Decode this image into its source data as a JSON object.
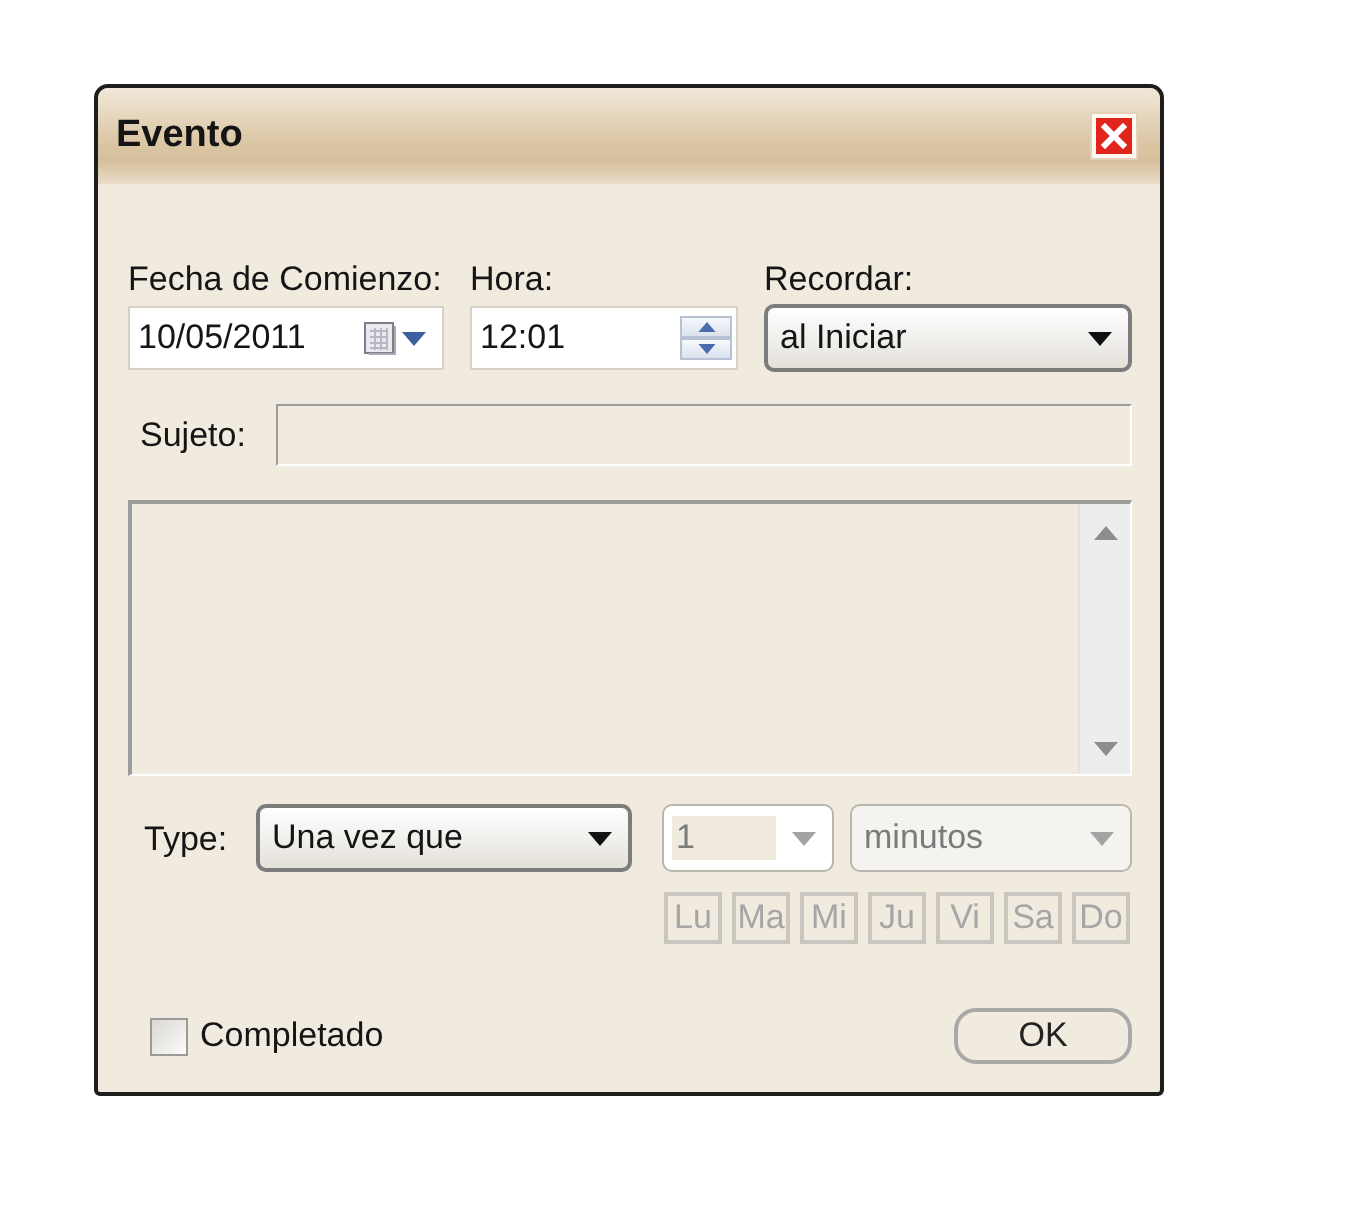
{
  "window": {
    "title": "Evento"
  },
  "start_date": {
    "label": "Fecha de Comienzo:",
    "value": "10/05/2011"
  },
  "time": {
    "label": "Hora:",
    "value": "12:01"
  },
  "reminder": {
    "label": "Recordar:",
    "value": "al Iniciar"
  },
  "subject": {
    "label": "Sujeto:",
    "disabled": true
  },
  "notes": {
    "disabled": true
  },
  "recurrence": {
    "label": "Type:",
    "value": "Una vez que",
    "interval": {
      "value": "1",
      "disabled": true
    },
    "unit": {
      "value": "minutos",
      "disabled": true
    },
    "days": [
      {
        "label": "Lu",
        "disabled": true
      },
      {
        "label": "Ma",
        "disabled": true
      },
      {
        "label": "Mi",
        "disabled": true
      },
      {
        "label": "Ju",
        "disabled": true
      },
      {
        "label": "Vi",
        "disabled": true
      },
      {
        "label": "Sa",
        "disabled": true
      },
      {
        "label": "Do",
        "disabled": true
      }
    ]
  },
  "completed": {
    "label": "Completado",
    "checked": false
  },
  "buttons": [
    {
      "label": "OK"
    }
  ]
}
